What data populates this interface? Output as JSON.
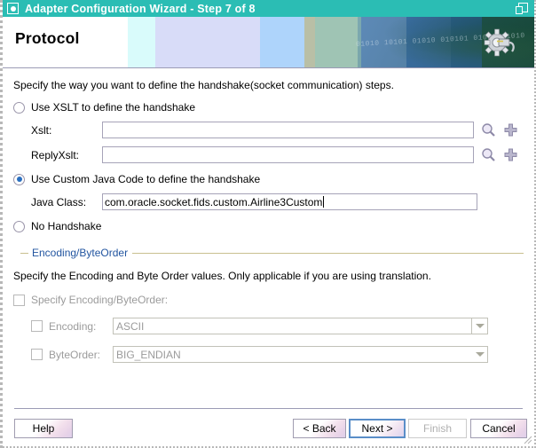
{
  "window": {
    "title": "Adapter Configuration Wizard - Step 7 of 8",
    "icon": "app-dot-icon",
    "restore_icon": "restore-window-icon",
    "title_bar_color": "#2bbdb4"
  },
  "header": {
    "page_title": "Protocol",
    "banner_binary": "01010 10101 01010 010101 010101010101",
    "banner_icon": "gear-cable-icon"
  },
  "main": {
    "intro": "Specify the way you want to define the handshake(socket communication) steps.",
    "handshake_options": [
      {
        "id": "use-xslt",
        "label": "Use XSLT to define the handshake",
        "selected": false
      },
      {
        "id": "use-custom-java",
        "label": "Use Custom Java Code to define the handshake",
        "selected": true
      },
      {
        "id": "no-handshake",
        "label": "No Handshake",
        "selected": false
      }
    ],
    "xslt_field": {
      "label": "Xslt:",
      "value": "",
      "placeholder": "",
      "browse_icon": "magnifier-icon",
      "add_icon": "plus-icon"
    },
    "reply_xslt_field": {
      "label": "ReplyXslt:",
      "value": "",
      "placeholder": "",
      "browse_icon": "magnifier-icon",
      "add_icon": "plus-icon"
    },
    "java_class_field": {
      "label": "Java Class:",
      "value": "com.oracle.socket.fids.custom.Airline3Custom",
      "placeholder": "",
      "focused": true
    },
    "encoding_group": {
      "title": "Encoding/ByteOrder",
      "title_color": "#2255a0",
      "rule_color": "#c9bf8f",
      "note": "Specify the Encoding and Byte Order values. Only applicable if you are using translation.",
      "specify_checkbox": {
        "label": "Specify Encoding/ByteOrder:",
        "checked": false,
        "enabled": false
      },
      "encoding": {
        "checkbox_label": "Encoding:",
        "checked": false,
        "enabled": false,
        "value": "ASCII",
        "options": [
          "ASCII"
        ]
      },
      "byteorder": {
        "checkbox_label": "ByteOrder:",
        "checked": false,
        "enabled": false,
        "value": "BIG_ENDIAN",
        "options": [
          "BIG_ENDIAN"
        ]
      }
    }
  },
  "footer": {
    "help": "Help",
    "back": "< Back",
    "next": "Next >",
    "finish": "Finish",
    "cancel": "Cancel",
    "next_focused": true,
    "finish_enabled": false
  }
}
